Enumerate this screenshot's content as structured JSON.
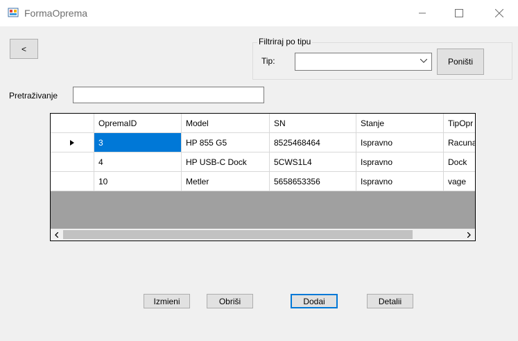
{
  "window": {
    "title": "FormaOprema"
  },
  "back_button": {
    "label": "<"
  },
  "filter": {
    "group_label": "Filtriraj po tipu",
    "tip_label": "Tip:",
    "tip_value": "",
    "reset_label": "Poništi"
  },
  "search": {
    "label": "Pretraživanje",
    "value": ""
  },
  "grid": {
    "columns": [
      "OpremaID",
      "Model",
      "SN",
      "Stanje",
      "TipOpr"
    ],
    "rows": [
      [
        "3",
        "HP 855 G5",
        "8525468464",
        "Ispravno",
        "Racuna"
      ],
      [
        "4",
        "HP USB-C Dock",
        "5CWS1L4",
        "Ispravno",
        "Dock"
      ],
      [
        "10",
        "Metler",
        "5658653356",
        "Ispravno",
        "vage"
      ]
    ]
  },
  "actions": {
    "edit": "Izmieni",
    "delete": "Obriši",
    "add": "Dodai",
    "details": "Detalii"
  }
}
